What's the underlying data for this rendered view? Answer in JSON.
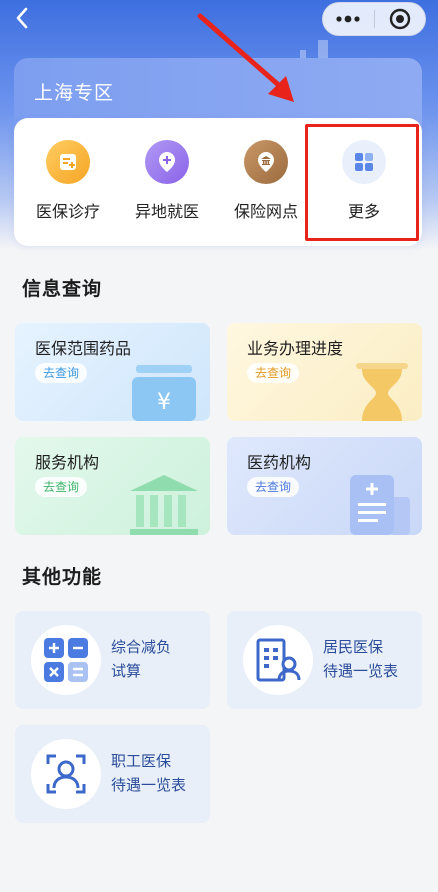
{
  "nav": {
    "back_icon": "chevron-left-icon",
    "capsule": {
      "more_icon": "ellipsis-icon",
      "close_icon": "target-circle-icon"
    }
  },
  "region": {
    "title": "上海专区"
  },
  "quick_actions": [
    {
      "label": "医保诊疗",
      "icon": "medical-card-icon",
      "color": "#f5a524"
    },
    {
      "label": "异地就医",
      "icon": "location-plus-icon",
      "color": "#8a63e8"
    },
    {
      "label": "保险网点",
      "icon": "bank-pin-icon",
      "color": "#9b6b3e"
    },
    {
      "label": "更多",
      "icon": "grid-icon",
      "color": "#5a86e8"
    }
  ],
  "info": {
    "title": "信息查询",
    "cards": [
      {
        "title": "医保范围药品",
        "button": "去查询",
        "bg": "#dcefff",
        "accent": "#3e98e0",
        "icon": "money-box-icon"
      },
      {
        "title": "业务办理进度",
        "button": "去查询",
        "bg": "#fdf2d4",
        "accent": "#e39a25",
        "icon": "hourglass-icon"
      },
      {
        "title": "服务机构",
        "button": "去查询",
        "bg": "#dcf5e6",
        "accent": "#3fb46b",
        "icon": "building-icon"
      },
      {
        "title": "医药机构",
        "button": "去查询",
        "bg": "#d8e3fb",
        "accent": "#4b79dc",
        "icon": "medical-document-icon"
      }
    ]
  },
  "other": {
    "title": "其他功能",
    "items": [
      {
        "line1": "综合减负",
        "line2": "试算",
        "icon": "calculator-icon"
      },
      {
        "line1": "居民医保",
        "line2": "待遇一览表",
        "icon": "resident-list-icon"
      },
      {
        "line1": "职工医保",
        "line2": "待遇一览表",
        "icon": "employee-id-icon"
      }
    ]
  },
  "colors": {
    "primary": "#3e6fe0",
    "highlight": "#e8231b"
  }
}
